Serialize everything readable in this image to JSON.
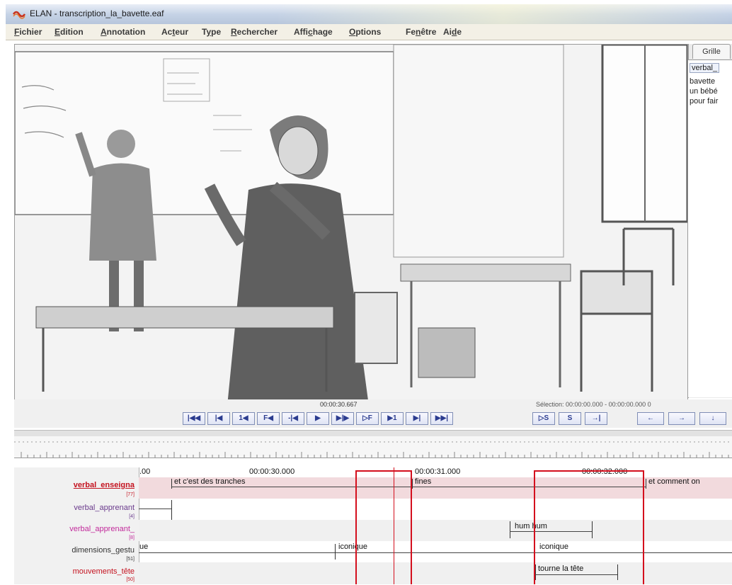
{
  "window": {
    "title": "ELAN - transcription_la_bavette.eaf"
  },
  "menu": [
    {
      "prefix": "",
      "mnemonic": "F",
      "rest": "ichier"
    },
    {
      "prefix": "",
      "mnemonic": "E",
      "rest": "dition"
    },
    {
      "prefix": "",
      "mnemonic": "A",
      "rest": "nnotation"
    },
    {
      "prefix": "Ac",
      "mnemonic": "t",
      "rest": "eur"
    },
    {
      "prefix": "T",
      "mnemonic": "y",
      "rest": "pe"
    },
    {
      "prefix": "",
      "mnemonic": "R",
      "rest": "echercher"
    },
    {
      "prefix": "Affi",
      "mnemonic": "c",
      "rest": "hage"
    },
    {
      "prefix": "",
      "mnemonic": "O",
      "rest": "ptions"
    },
    {
      "prefix": "Fe",
      "mnemonic": "n",
      "rest": "être"
    },
    {
      "prefix": "Ai",
      "mnemonic": "d",
      "rest": "e"
    }
  ],
  "grid_panel": {
    "tab": "Grille",
    "header": "verbal_",
    "lines": [
      "bavette",
      "un bébé",
      "pour fair"
    ]
  },
  "player": {
    "current_time": "00:00:30.667",
    "selection": "Sélection: 00:00:00.000 - 00:00:00.000  0",
    "buttons": [
      "|◀◀",
      "|◀",
      "1◀",
      "F◀",
      "-|◀",
      "▶",
      "▶|▶",
      "▷F",
      "▶1",
      "▶|",
      "▶▶|"
    ],
    "buttons2": [
      "▷S",
      "S",
      "→|"
    ],
    "buttons3": [
      "←",
      "→",
      "↓"
    ]
  },
  "timeline": {
    "ticks": [
      ".00",
      "00:00:30.000",
      "00:00:31.000",
      "00:00:32.000"
    ],
    "tiers": [
      {
        "name": "verbal_enseigna",
        "count": "[77]",
        "color": "#c4121f"
      },
      {
        "name": "verbal_apprenant",
        "count": "[4]",
        "color": "#6a3a8c"
      },
      {
        "name": "verbal_apprenant_",
        "count": "[8]",
        "color": "#c22a9b"
      },
      {
        "name": "dimensions_gestu",
        "count": "[51]",
        "color": "#333333"
      },
      {
        "name": "mouvements_tête",
        "count": "[50]",
        "color": "#c4121f"
      }
    ],
    "annotations": {
      "t1a": "et c'est des tranches",
      "t1b": "fines",
      "t1c": "et comment on",
      "t3a": "hum hum",
      "t4a": "ue",
      "t4b": "iconique",
      "t4c": "iconique",
      "t5a": "tourne la tête"
    }
  },
  "colors": {
    "highlight_red": "#d40f1d",
    "tier_highlight": "#f2dadd"
  }
}
